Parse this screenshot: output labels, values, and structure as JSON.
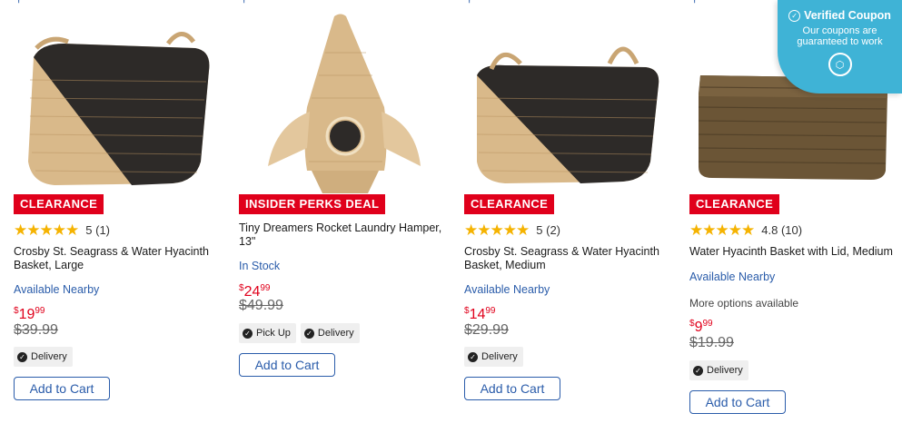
{
  "products": [
    {
      "badge": "CLEARANCE",
      "rating_value": "5",
      "rating_count": "(1)",
      "stars": 5,
      "title": "Crosby St. Seagrass & Water Hyacinth Basket, Large",
      "availability": "Available Nearby",
      "price_currency": "$",
      "price_dollars": "19",
      "price_cents": "99",
      "was_price": "$39.99",
      "chips": [
        "Delivery"
      ],
      "cart_label": "Add to Cart",
      "image": "black-triangle-seagrass-basket"
    },
    {
      "badge": "INSIDER PERKS DEAL",
      "title": "Tiny Dreamers Rocket Laundry Hamper, 13\"",
      "availability": "In Stock",
      "price_currency": "$",
      "price_dollars": "24",
      "price_cents": "99",
      "was_price": "$49.99",
      "chips": [
        "Pick Up",
        "Delivery"
      ],
      "cart_label": "Add to Cart",
      "image": "rocket-hamper"
    },
    {
      "badge": "CLEARANCE",
      "rating_value": "5",
      "rating_count": "(2)",
      "stars": 5,
      "title": "Crosby St. Seagrass & Water Hyacinth Basket, Medium",
      "availability": "Available Nearby",
      "price_currency": "$",
      "price_dollars": "14",
      "price_cents": "99",
      "was_price": "$29.99",
      "chips": [
        "Delivery"
      ],
      "cart_label": "Add to Cart",
      "image": "black-triangle-seagrass-basket"
    },
    {
      "badge": "CLEARANCE",
      "rating_value": "4.8",
      "rating_count": "(10)",
      "stars": 5,
      "title": "Water Hyacinth Basket with Lid, Medium",
      "availability": "Available Nearby",
      "more_options": "More options available",
      "price_currency": "$",
      "price_dollars": "9",
      "price_cents": "99",
      "was_price": "$19.99",
      "chips": [
        "Delivery"
      ],
      "cart_label": "Add to Cart",
      "image": "lidded-hyacinth-basket"
    }
  ],
  "coupon_popup": {
    "title": "Verified Coupon",
    "subtitle": "Our coupons are guaranteed to work"
  },
  "colors": {
    "badge_red": "#e0001b",
    "link_blue": "#2a5caa",
    "star_gold": "#f5b301",
    "coupon_teal": "#3fb3d6"
  }
}
